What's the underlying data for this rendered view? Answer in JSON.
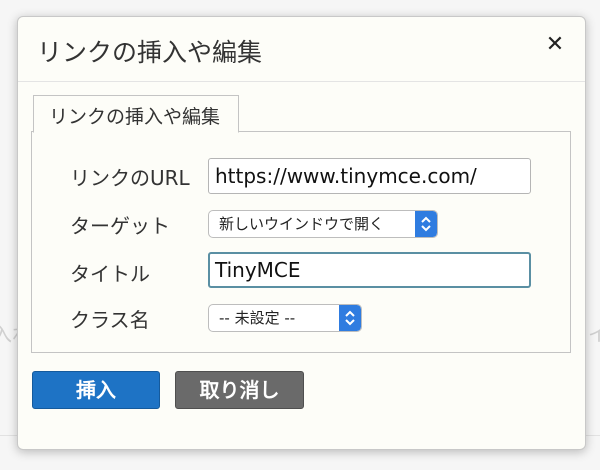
{
  "background": {
    "left_hint": "入れ",
    "right_hint": "イ"
  },
  "dialog": {
    "title": "リンクの挿入や編集",
    "close_glyph": "✕"
  },
  "tabs": [
    {
      "label": "リンクの挿入や編集"
    }
  ],
  "form": {
    "url_label": "リンクのURL",
    "url_value": "https://www.tinymce.com/",
    "target_label": "ターゲット",
    "target_value": "新しいウインドウで開く",
    "title_label": "タイトル",
    "title_value": "TinyMCE",
    "class_label": "クラス名",
    "class_value": "-- 未設定 --"
  },
  "buttons": {
    "insert_label": "挿入",
    "cancel_label": "取り消し"
  },
  "colors": {
    "primary": "#1e73c5",
    "secondary": "#6a6a6a",
    "focus_border": "#5a8fa3"
  }
}
